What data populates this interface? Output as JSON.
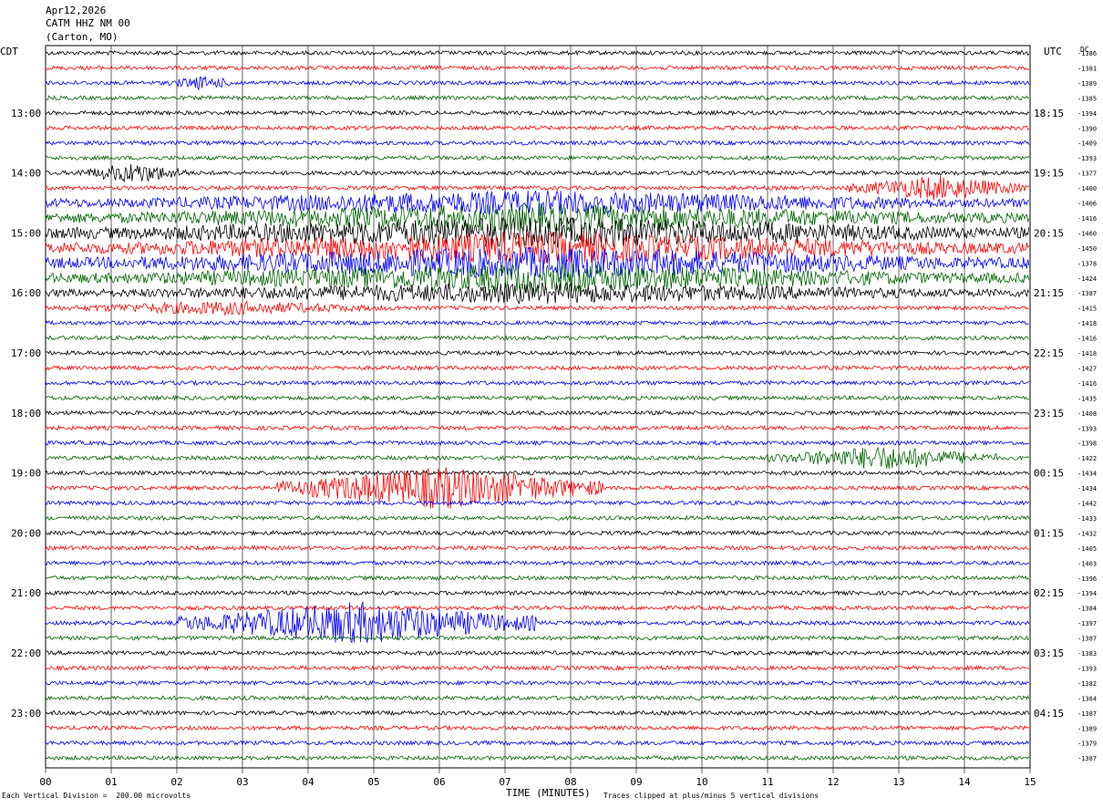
{
  "header": {
    "date": "Apr12,2026",
    "station": "CATM HHZ NM 00",
    "location": "(Carton, MO)"
  },
  "axis_labels": {
    "left_timezone": "CDT",
    "right_timezone": "UTC",
    "dc": "DC",
    "x_title": "TIME (MINUTES)"
  },
  "footer": {
    "scale_note": "Each Vertical Division =  200.00 microvolts",
    "clip_note": "Traces clipped at plus/minus 5 vertical divisions"
  },
  "colors": {
    "trace_cycle": [
      "#000000",
      "#ff0000",
      "#0000ff",
      "#006400"
    ],
    "grid": "#000000"
  },
  "chart_data": {
    "type": "line",
    "description_free": true,
    "x_ticks": [
      "00",
      "01",
      "02",
      "03",
      "04",
      "05",
      "06",
      "07",
      "08",
      "09",
      "10",
      "11",
      "12",
      "13",
      "14",
      "15"
    ],
    "xlim": [
      0,
      15
    ],
    "left_hour_labels": [
      "13:00",
      "14:00",
      "15:00",
      "16:00",
      "17:00",
      "18:00",
      "19:00",
      "20:00",
      "21:00",
      "22:00",
      "23:00"
    ],
    "right_hour_labels": [
      "18:15",
      "19:15",
      "20:15",
      "21:15",
      "22:15",
      "23:15",
      "00:15",
      "01:15",
      "02:15",
      "03:15",
      "04:15"
    ],
    "dc_offsets": [
      "-1386",
      "-1381",
      "-1389",
      "-1385",
      "-1394",
      "-1390",
      "-1409",
      "-1393",
      "-1377",
      "-1400",
      "-1406",
      "-1416",
      "-1460",
      "-1450",
      "-1378",
      "-1424",
      "-1387",
      "-1415",
      "-1418",
      "-1416",
      "-1418",
      "-1427",
      "-1416",
      "-1435",
      "-1408",
      "-1393",
      "-1398",
      "-1422",
      "-1434",
      "-1434",
      "-1442",
      "-1433",
      "-1432",
      "-1405",
      "-1403",
      "-1396",
      "-1394",
      "-1384",
      "-1397",
      "-1387",
      "-1383",
      "-1393",
      "-1382",
      "-1384",
      "-1387",
      "-1389",
      "-1379",
      "-1387"
    ],
    "trace_count": 48,
    "trace_activity": [
      {
        "trace": 2,
        "events": [
          {
            "start": 1.8,
            "end": 3.0,
            "amp": 8
          }
        ]
      },
      {
        "trace": 8,
        "events": [
          {
            "start": 0.5,
            "end": 2.2,
            "amp": 12
          }
        ]
      },
      {
        "trace": 9,
        "events": [
          {
            "start": 12.2,
            "end": 15,
            "amp": 14
          }
        ]
      },
      {
        "trace": 10,
        "events": [
          {
            "start": 0,
            "end": 15,
            "amp": 14
          }
        ]
      },
      {
        "trace": 11,
        "events": [
          {
            "start": 0,
            "end": 15,
            "amp": 16
          }
        ]
      },
      {
        "trace": 12,
        "events": [
          {
            "start": 0,
            "end": 15,
            "amp": 18
          }
        ]
      },
      {
        "trace": 13,
        "events": [
          {
            "start": 0,
            "end": 15,
            "amp": 18
          }
        ]
      },
      {
        "trace": 14,
        "events": [
          {
            "start": 0,
            "end": 15,
            "amp": 18
          }
        ]
      },
      {
        "trace": 15,
        "events": [
          {
            "start": 0,
            "end": 15,
            "amp": 16
          }
        ]
      },
      {
        "trace": 16,
        "events": [
          {
            "start": 0,
            "end": 15,
            "amp": 12
          }
        ]
      },
      {
        "trace": 17,
        "events": [
          {
            "start": 0,
            "end": 5.5,
            "amp": 8
          }
        ]
      },
      {
        "trace": 27,
        "events": [
          {
            "start": 11.0,
            "end": 14.5,
            "amp": 14
          }
        ]
      },
      {
        "trace": 29,
        "events": [
          {
            "start": 3.5,
            "end": 8.5,
            "amp": 24
          }
        ]
      },
      {
        "trace": 38,
        "events": [
          {
            "start": 2.0,
            "end": 7.5,
            "amp": 24
          }
        ]
      }
    ]
  }
}
